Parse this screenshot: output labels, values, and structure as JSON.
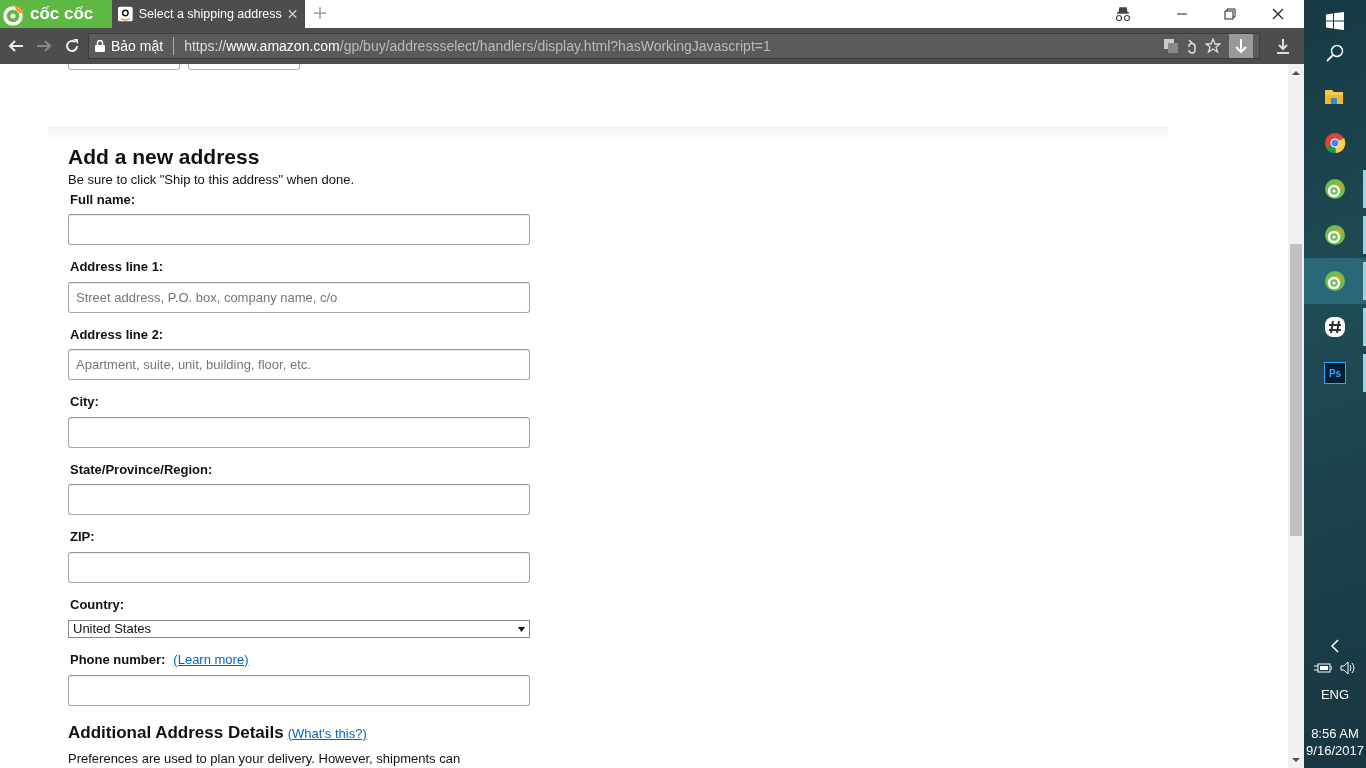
{
  "browser": {
    "brand": "cốc cốc",
    "tabs": [
      {
        "title": "Select a shipping address",
        "selected": true
      }
    ],
    "new_tab": "+",
    "security_label": "Bảo mật",
    "url": {
      "scheme": "https://",
      "host": "www.amazon.com",
      "path": "/gp/buy/addressselect/handlers/display.html?hasWorkingJavascript=1"
    }
  },
  "page": {
    "title": "Add a new address",
    "note": "Be sure to click \"Ship to this address\" when done.",
    "fields": [
      {
        "kind": "text",
        "label": "Full name:"
      },
      {
        "kind": "text",
        "label": "Address line 1:",
        "placeholder": "Street address, P.O. box, company name, c/o"
      },
      {
        "kind": "text",
        "label": "Address line 2:",
        "placeholder": "Apartment, suite, unit, building, floor, etc."
      },
      {
        "kind": "text",
        "label": "City:"
      },
      {
        "kind": "text",
        "label": "State/Province/Region:"
      },
      {
        "kind": "text",
        "label": "ZIP:"
      },
      {
        "kind": "select",
        "label": "Country:",
        "value": "United States"
      },
      {
        "kind": "text",
        "label": "Phone number:",
        "link": "(Learn more)"
      }
    ],
    "details_title": "Additional Address Details",
    "details_link": "(What's this?)",
    "details_text": "Preferences are used to plan your delivery. However, shipments can"
  },
  "taskbar": {
    "apps": [
      {
        "kind": "explorer",
        "running": false,
        "selected": false
      },
      {
        "kind": "chrome",
        "running": false,
        "selected": false
      },
      {
        "kind": "coccoc",
        "running": true,
        "selected": false
      },
      {
        "kind": "coccoc",
        "running": true,
        "selected": false
      },
      {
        "kind": "coccoc",
        "running": true,
        "selected": true
      },
      {
        "kind": "slack",
        "running": true,
        "selected": false
      },
      {
        "kind": "photoshop",
        "icon_text": "Ps",
        "running": true,
        "selected": false
      }
    ],
    "language": "ENG",
    "time": "8:56 AM",
    "date": "9/16/2017"
  }
}
